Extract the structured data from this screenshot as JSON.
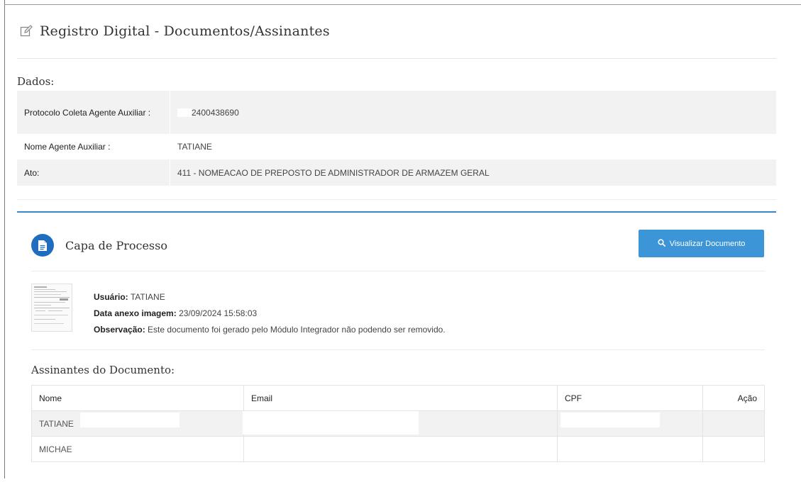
{
  "page": {
    "title": "Registro Digital - Documentos/Assinantes",
    "title_icon": "edit-icon"
  },
  "dados": {
    "label": "Dados:",
    "rows": [
      {
        "key": "Protocolo Coleta Agente Auxiliar :",
        "value": "2400438690"
      },
      {
        "key": "Nome Agente Auxiliar :",
        "value": "TATIANE"
      },
      {
        "key": "Ato:",
        "value": "411 - NOMEACAO DE PREPOSTO DE ADMINISTRADOR DE ARMAZEM GERAL"
      }
    ]
  },
  "document": {
    "title": "Capa de Processo",
    "icon": "document-icon",
    "view_button": {
      "label": "Visualizar Documento",
      "icon": "search-icon"
    },
    "usuario_label": "Usuário:",
    "usuario_value": "TATIANE",
    "data_label": "Data anexo imagem:",
    "data_value": "23/09/2024 15:58:03",
    "obs_label": "Observação:",
    "obs_value": "Este documento foi gerado pelo Módulo Integrador não podendo ser removido."
  },
  "signers": {
    "label": "Assinantes do Documento:",
    "columns": [
      "Nome",
      "Email",
      "CPF",
      "Ação"
    ],
    "rows": [
      {
        "nome": "TATIANE",
        "email": "",
        "cpf": "",
        "acao": ""
      },
      {
        "nome": "MICHAE",
        "email": "",
        "cpf": "",
        "acao": ""
      }
    ]
  },
  "colors": {
    "accent": "#3a87c8",
    "button": "#3c95d6",
    "doc_icon": "#1f6dbf",
    "row_stripe": "#f2f2f2"
  }
}
